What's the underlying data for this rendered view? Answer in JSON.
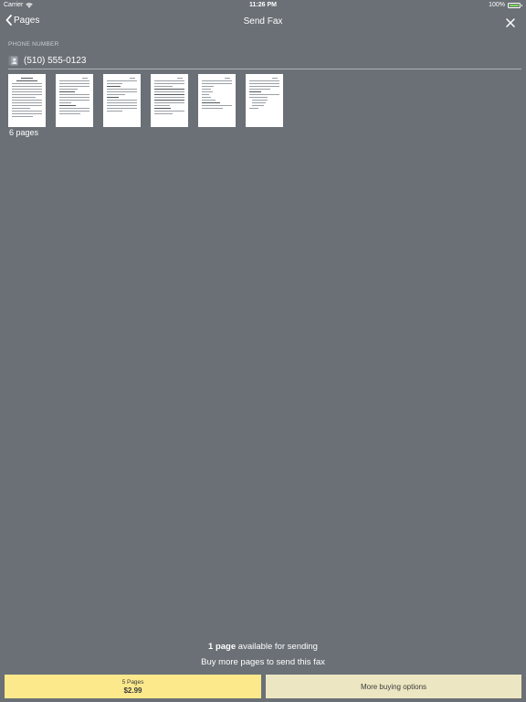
{
  "status_bar": {
    "carrier": "Carrier",
    "time": "11:26 PM",
    "battery": "100%",
    "battery_color": "#7ed957"
  },
  "nav": {
    "back_label": "Pages",
    "title": "Send Fax"
  },
  "phone": {
    "label": "PHONE NUMBER",
    "value": "(510) 555-0123"
  },
  "pages": {
    "count_label": "6 pages",
    "thumbnails": [
      "page-1",
      "page-2",
      "page-3",
      "page-4",
      "page-5",
      "page-6"
    ]
  },
  "footer": {
    "available_count": "1 page",
    "available_suffix": " available for sending",
    "buy_more_text": "Buy more pages to send this fax",
    "buy_button": {
      "pages": "5 Pages",
      "price": "$2.99"
    },
    "more_options_label": "More buying options"
  },
  "colors": {
    "background": "#6a7076",
    "buy_button": "#fbe98c",
    "more_button": "#ece6c2"
  }
}
